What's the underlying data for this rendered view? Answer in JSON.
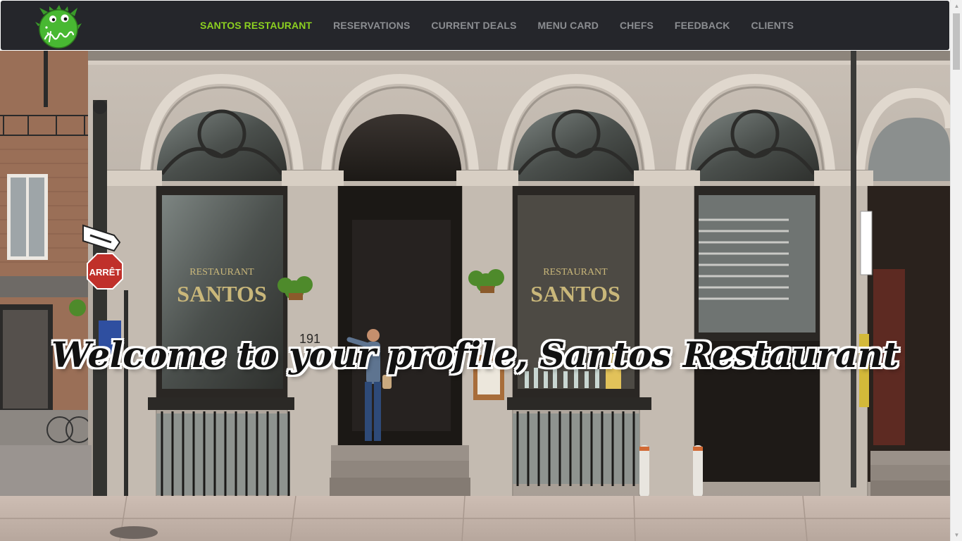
{
  "nav": {
    "logo_icon": "green-monster-logo-icon",
    "links": [
      {
        "label": "SANTOS RESTAURANT",
        "active": true
      },
      {
        "label": "RESERVATIONS",
        "active": false
      },
      {
        "label": "CURRENT DEALS",
        "active": false
      },
      {
        "label": "MENU CARD",
        "active": false
      },
      {
        "label": "CHEFS",
        "active": false
      },
      {
        "label": "FEEDBACK",
        "active": false
      },
      {
        "label": "CLIENTS",
        "active": false
      }
    ],
    "colors": {
      "background": "#25262b",
      "link": "#8b8d91",
      "active": "#8cd020"
    }
  },
  "hero": {
    "welcome_text": "Welcome to your profile, Santos Restaurant",
    "photo_sign_restaurant": "RESTAURANT",
    "photo_sign_name": "SANTOS",
    "photo_street_number": "191",
    "photo_stop_sign": "ARRÊT"
  },
  "scrollbar": {
    "up_icon": "scroll-up-arrow-icon",
    "down_icon": "scroll-down-arrow-icon"
  }
}
